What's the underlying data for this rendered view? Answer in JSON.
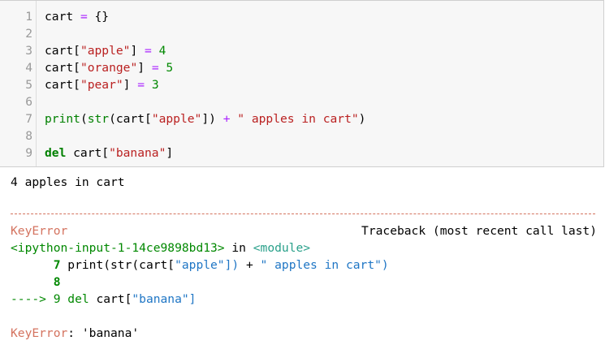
{
  "code_cell": {
    "line_numbers": [
      "1",
      "2",
      "3",
      "4",
      "5",
      "6",
      "7",
      "8",
      "9"
    ],
    "lines": [
      {
        "tokens": [
          {
            "t": "cart ",
            "c": "#000000"
          },
          {
            "t": "=",
            "c": "#aa22ff"
          },
          {
            "t": " {}",
            "c": "#000000"
          }
        ]
      },
      {
        "tokens": []
      },
      {
        "tokens": [
          {
            "t": "cart[",
            "c": "#000000"
          },
          {
            "t": "\"apple\"",
            "c": "#ba2121"
          },
          {
            "t": "] ",
            "c": "#000000"
          },
          {
            "t": "=",
            "c": "#aa22ff"
          },
          {
            "t": " ",
            "c": "#000000"
          },
          {
            "t": "4",
            "c": "#008800"
          }
        ]
      },
      {
        "tokens": [
          {
            "t": "cart[",
            "c": "#000000"
          },
          {
            "t": "\"orange\"",
            "c": "#ba2121"
          },
          {
            "t": "] ",
            "c": "#000000"
          },
          {
            "t": "=",
            "c": "#aa22ff"
          },
          {
            "t": " ",
            "c": "#000000"
          },
          {
            "t": "5",
            "c": "#008800"
          }
        ]
      },
      {
        "tokens": [
          {
            "t": "cart[",
            "c": "#000000"
          },
          {
            "t": "\"pear\"",
            "c": "#ba2121"
          },
          {
            "t": "] ",
            "c": "#000000"
          },
          {
            "t": "=",
            "c": "#aa22ff"
          },
          {
            "t": " ",
            "c": "#000000"
          },
          {
            "t": "3",
            "c": "#008800"
          }
        ]
      },
      {
        "tokens": []
      },
      {
        "tokens": [
          {
            "t": "print",
            "c": "#008000"
          },
          {
            "t": "(",
            "c": "#000000"
          },
          {
            "t": "str",
            "c": "#008000"
          },
          {
            "t": "(cart[",
            "c": "#000000"
          },
          {
            "t": "\"apple\"",
            "c": "#ba2121"
          },
          {
            "t": "]) ",
            "c": "#000000"
          },
          {
            "t": "+",
            "c": "#aa22ff"
          },
          {
            "t": " ",
            "c": "#000000"
          },
          {
            "t": "\" apples in cart\"",
            "c": "#ba2121"
          },
          {
            "t": ")",
            "c": "#000000"
          }
        ]
      },
      {
        "tokens": []
      },
      {
        "tokens": [
          {
            "t": "del",
            "c": "#008000",
            "b": true
          },
          {
            "t": " cart[",
            "c": "#000000"
          },
          {
            "t": "\"banana\"",
            "c": "#ba2121"
          },
          {
            "t": "]",
            "c": "#000000"
          }
        ]
      }
    ]
  },
  "output": {
    "stdout": "4 apples in cart",
    "separator": "---------------------------------------------------------------------------",
    "error_name": "KeyError",
    "traceback_header": "Traceback (most recent call last)",
    "input_ref": "<ipython-input-1-14ce9898bd13>",
    "in_word": " in ",
    "module_ref": "<module>",
    "tb_lines": [
      {
        "tokens": [
          {
            "t": "      7 ",
            "c": "#008800",
            "b": true
          },
          {
            "t": "print(str(cart[",
            "c": "#000000"
          },
          {
            "t": "\"apple\"",
            "c": "#1f76c5"
          },
          {
            "t": "]) ",
            "c": "#1f76c5"
          },
          {
            "t": "+",
            "c": "#000000"
          },
          {
            "t": " \" apples in cart\")",
            "c": "#1f76c5"
          }
        ]
      },
      {
        "tokens": [
          {
            "t": "      8",
            "c": "#008800",
            "b": true
          }
        ]
      },
      {
        "tokens": [
          {
            "t": "----> 9 ",
            "c": "#008800"
          },
          {
            "t": "del",
            "c": "#008800"
          },
          {
            "t": " cart[",
            "c": "#000000"
          },
          {
            "t": "\"banana\"",
            "c": "#1f76c5"
          },
          {
            "t": "]",
            "c": "#1f76c5"
          }
        ]
      }
    ],
    "final_error_name": "KeyError",
    "final_error_msg": ": 'banana'"
  },
  "colors": {
    "error_red": "#d4735f",
    "module_green": "#29a08a",
    "input_green": "#008800"
  }
}
